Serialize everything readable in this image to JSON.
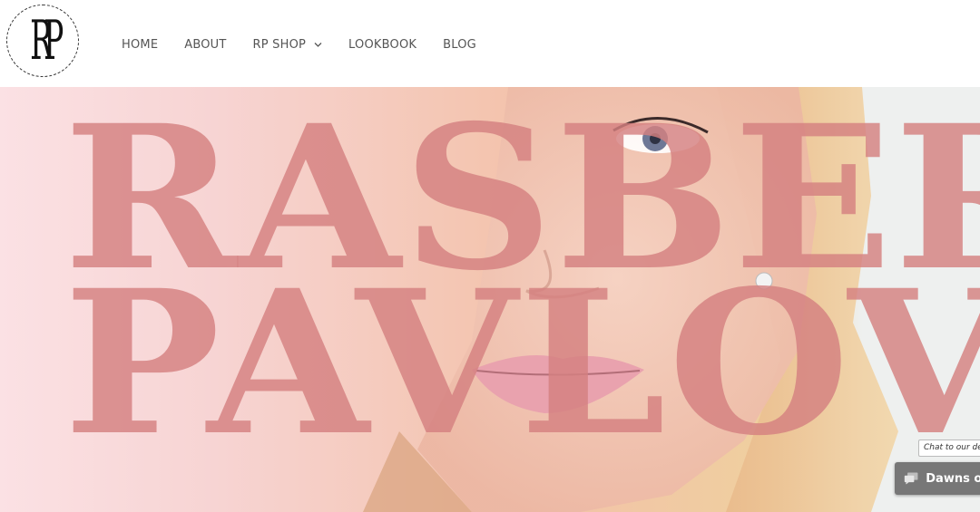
{
  "brand": {
    "logo_text": "RP"
  },
  "nav": {
    "items": [
      {
        "label": "HOME"
      },
      {
        "label": "ABOUT"
      },
      {
        "label": "RP SHOP",
        "has_dropdown": true
      },
      {
        "label": "LOOKBOOK"
      },
      {
        "label": "BLOG"
      }
    ]
  },
  "hero": {
    "line1": "RASBERY",
    "line2": "PAVLOVA"
  },
  "chat": {
    "prompt": "Chat to our des",
    "status": "Dawns onl",
    "icon": "chat-bubbles-icon"
  },
  "colors": {
    "hero_text": "#d48080",
    "chat_bar": "#777777",
    "nav_text": "#555555"
  }
}
